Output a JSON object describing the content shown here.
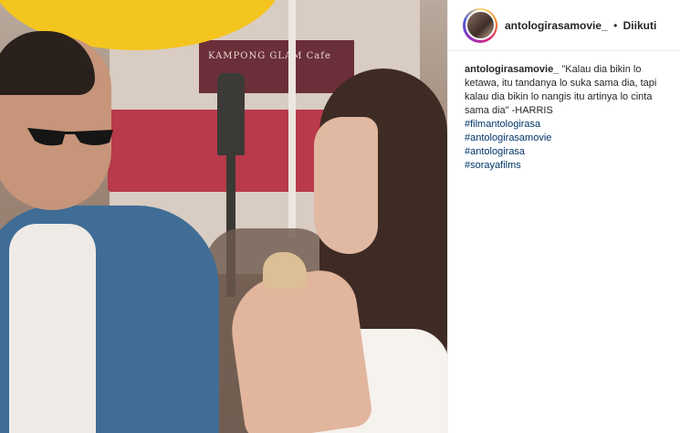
{
  "post": {
    "photo_description_icon": "photo-icon",
    "sign_text": "KAMPONG GLAM Cafe"
  },
  "header": {
    "username": "antologirasamovie_",
    "separator": "•",
    "follow_status": "Diikuti"
  },
  "caption": {
    "username": "antologirasamovie_",
    "text": "\"Kalau dia bikin lo ketawa, itu tandanya lo suka sama dia, tapi kalau dia bikin lo nangis itu artinya lo cinta sama dia\" -HARRIS",
    "hashtags": [
      "#filmantologirasa",
      "#antologirasamovie",
      "#antologirasa",
      "#sorayafilms"
    ]
  },
  "colors": {
    "link": "#003569",
    "text": "#262626"
  }
}
